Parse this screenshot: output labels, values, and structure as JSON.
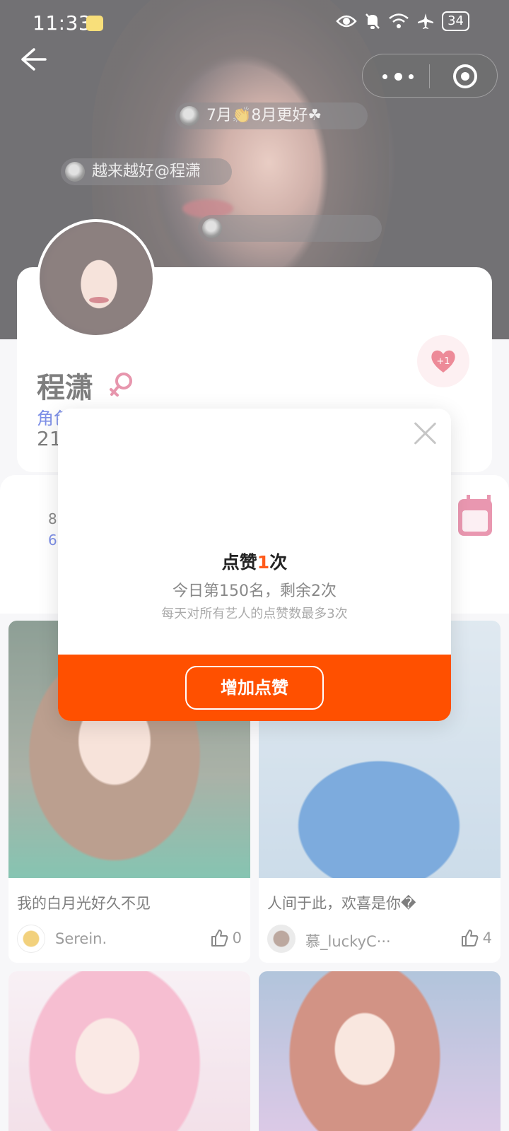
{
  "status_bar": {
    "time": "11:33",
    "battery": "34",
    "icons": [
      "app-notification-icon",
      "eye-icon",
      "mute-bell-icon",
      "wifi-icon",
      "airplane-icon",
      "battery-icon"
    ]
  },
  "nav": {
    "back_icon": "back-arrow-icon",
    "capsule_icons": [
      "more-dots-icon",
      "target-close-icon"
    ]
  },
  "danmaku": [
    {
      "text": "7月👏8月更好☘"
    },
    {
      "text": "越来越好@程潇"
    },
    {
      "text": ""
    }
  ],
  "profile": {
    "name": "程潇",
    "gender_icon": "female-icon",
    "role_label": "角色指数",
    "count": "21",
    "like_badge": "+1"
  },
  "stats": {
    "line1": "8",
    "line2": "6"
  },
  "feed": [
    {
      "title": "我的白月光好久不见",
      "author": "Serein.",
      "likes": "0"
    },
    {
      "title": "人间于此，欢喜是你�",
      "author": "慕_luckyC···",
      "likes": "4"
    }
  ],
  "modal": {
    "title_prefix": "点赞",
    "title_count": "1",
    "title_suffix": "次",
    "rank_text": "今日第150名，剩余2次",
    "note_text": "每天对所有艺人的点赞数最多3次",
    "button_label": "增加点赞"
  },
  "colors": {
    "accent_orange": "#ff5000",
    "female_pink": "#d64a73",
    "link_blue": "#1f3fd6"
  }
}
